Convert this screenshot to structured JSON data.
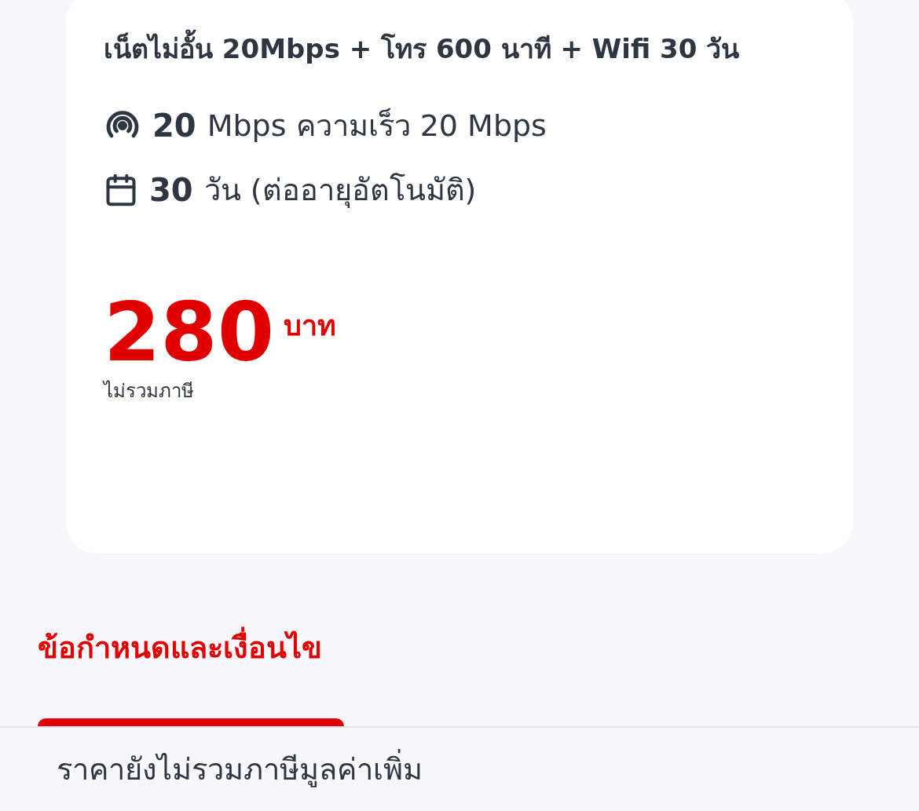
{
  "plan": {
    "title": "เน็ตไม่อั้น 20Mbps + โทร 600 นาที + Wifi 30 วัน",
    "features": [
      {
        "kind": "speed",
        "value": "20",
        "text": "Mbps ความเร็ว 20 Mbps"
      },
      {
        "kind": "duration",
        "value": "30",
        "text": "วัน (ต่ออายุอัตโนมัติ)"
      }
    ],
    "price": {
      "amount": "280",
      "unit": "บาท",
      "note": "ไม่รวมภาษี"
    }
  },
  "terms_heading": "ข้อกำหนดและเงื่อนไข",
  "footer_note": "ราคายังไม่รวมภาษีมูลค่าเพิ่ม"
}
